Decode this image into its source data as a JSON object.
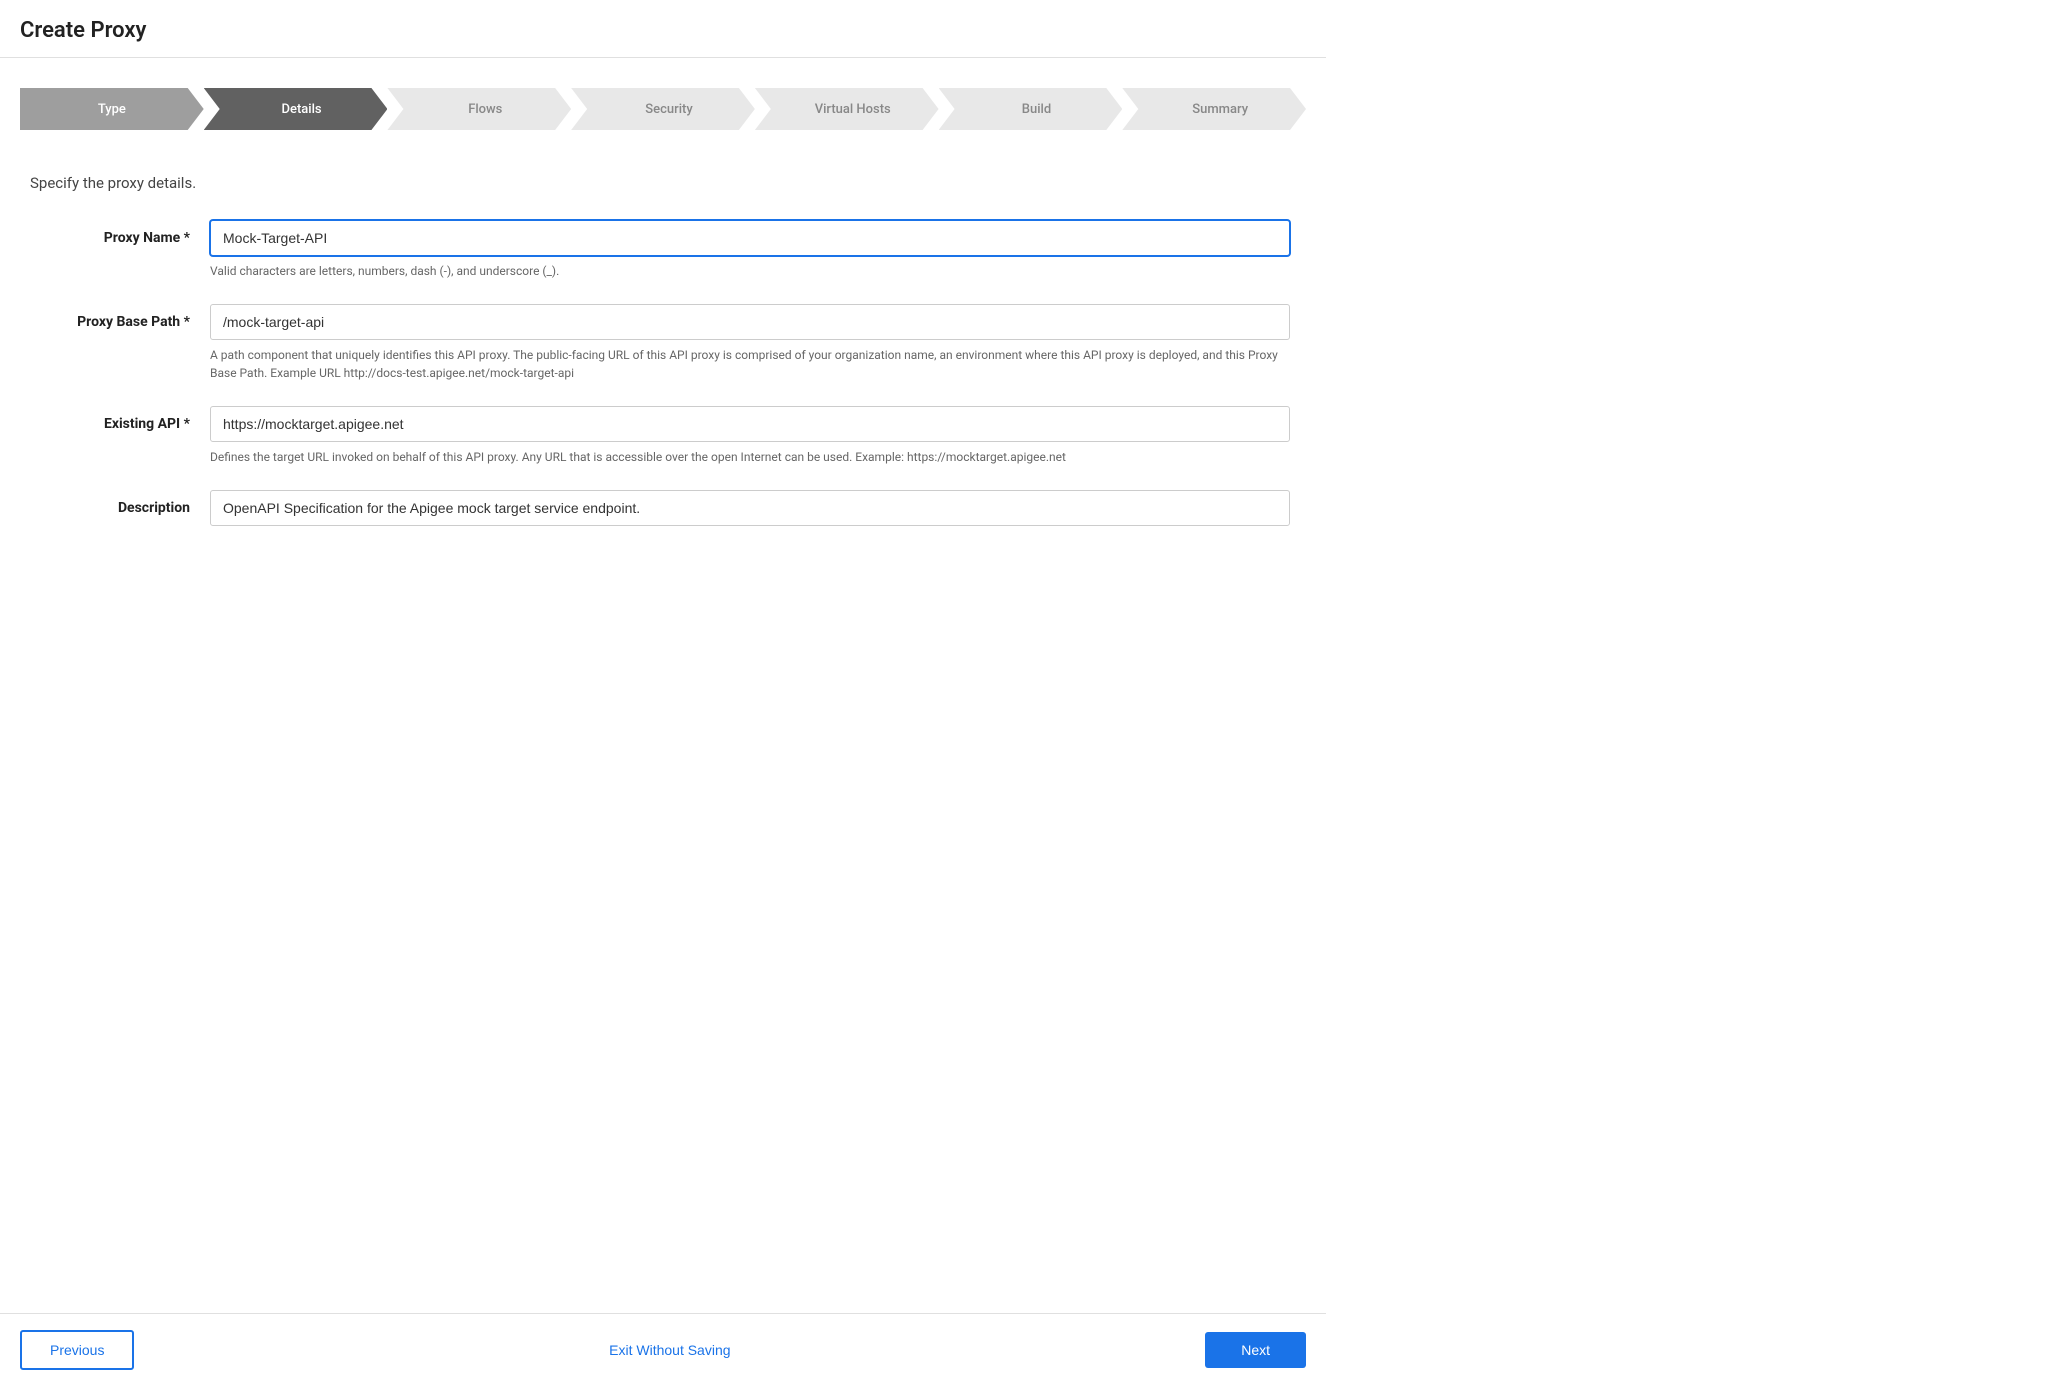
{
  "header": {
    "title": "Create Proxy"
  },
  "wizard": {
    "steps": [
      {
        "id": "type",
        "label": "Type",
        "state": "completed"
      },
      {
        "id": "details",
        "label": "Details",
        "state": "active"
      },
      {
        "id": "flows",
        "label": "Flows",
        "state": "inactive"
      },
      {
        "id": "security",
        "label": "Security",
        "state": "inactive"
      },
      {
        "id": "virtual-hosts",
        "label": "Virtual Hosts",
        "state": "inactive"
      },
      {
        "id": "build",
        "label": "Build",
        "state": "inactive"
      },
      {
        "id": "summary",
        "label": "Summary",
        "state": "inactive"
      }
    ]
  },
  "form": {
    "section_description": "Specify the proxy details.",
    "fields": {
      "proxy_name": {
        "label": "Proxy Name *",
        "value": "Mock-Target-API",
        "hint": "Valid characters are letters, numbers, dash (-), and underscore (_)."
      },
      "proxy_base_path": {
        "label": "Proxy Base Path *",
        "value": "/mock-target-api",
        "hint": "A path component that uniquely identifies this API proxy. The public-facing URL of this API proxy is comprised of your organization name, an environment where this API proxy is deployed, and this Proxy Base Path. Example URL http://docs-test.apigee.net/mock-target-api"
      },
      "existing_api": {
        "label": "Existing API *",
        "value": "https://mocktarget.apigee.net",
        "hint": "Defines the target URL invoked on behalf of this API proxy. Any URL that is accessible over the open Internet can be used. Example: https://mocktarget.apigee.net"
      },
      "description": {
        "label": "Description",
        "value": "OpenAPI Specification for the Apigee mock target service endpoint.",
        "hint": ""
      }
    }
  },
  "footer": {
    "previous_label": "Previous",
    "exit_label": "Exit Without Saving",
    "next_label": "Next"
  }
}
